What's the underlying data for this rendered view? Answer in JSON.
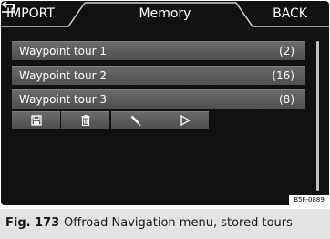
{
  "header": {
    "import_label": "IMPORT",
    "title": "Memory",
    "back_label": "BACK"
  },
  "tours": [
    {
      "name": "Waypoint tour 1",
      "count": "(2)"
    },
    {
      "name": "Waypoint tour 2",
      "count": "(16)"
    },
    {
      "name": "Waypoint tour 3",
      "count": "(8)"
    }
  ],
  "actions": [
    "save-icon",
    "delete-icon",
    "edit-icon",
    "play-icon"
  ],
  "image_code": "B5F-0889",
  "caption": {
    "figure": "Fig. 173",
    "text": "Offroad Navigation menu, stored tours"
  },
  "colors": {
    "screen_bg": "#111111",
    "row_bg": "#5a5a5a",
    "caption_bg": "#e3e3e3",
    "text": "#ffffff"
  }
}
